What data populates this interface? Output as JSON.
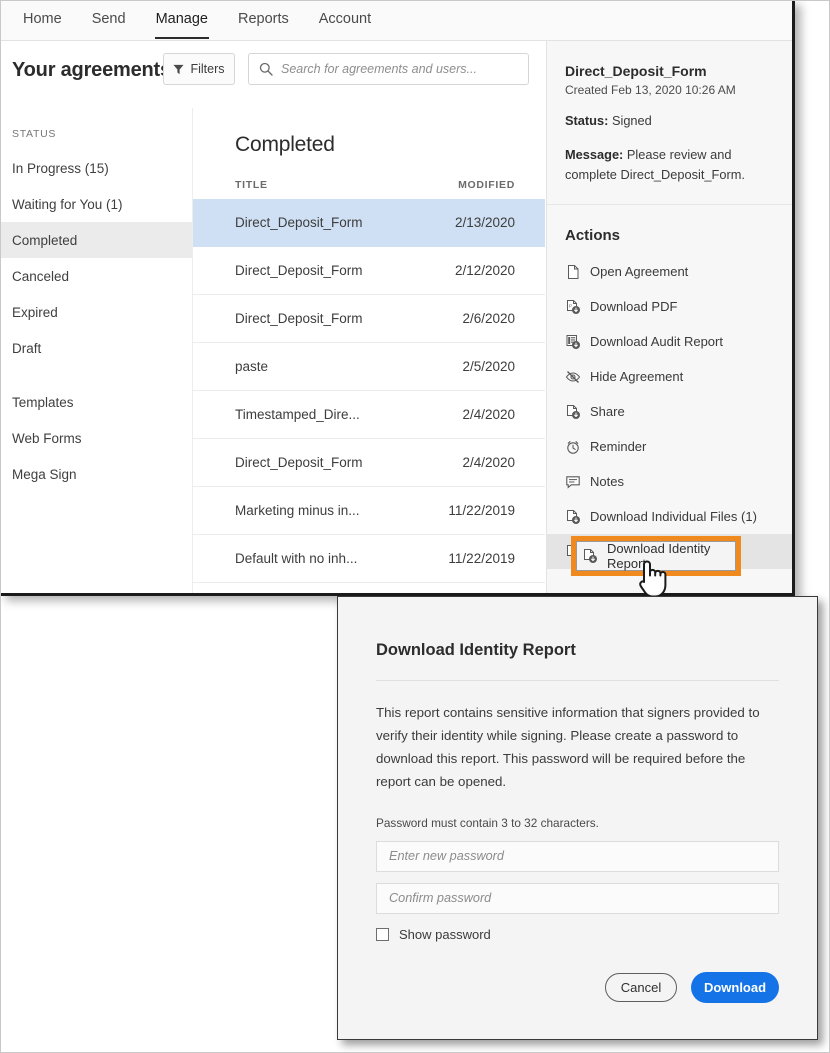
{
  "colors": {
    "accent_blue": "#1473E6",
    "callout_orange": "#F08A1E",
    "selected_row_blue": "#CFE0F4",
    "panel_gray": "#F7F7F7"
  },
  "topnav": {
    "items": [
      {
        "label": "Home",
        "active": false
      },
      {
        "label": "Send",
        "active": false
      },
      {
        "label": "Manage",
        "active": true
      },
      {
        "label": "Reports",
        "active": false
      },
      {
        "label": "Account",
        "active": false
      }
    ]
  },
  "header": {
    "title": "Your agreements",
    "filters_label": "Filters",
    "filters_icon": "funnel-icon",
    "search": {
      "icon": "search-icon",
      "value": "",
      "placeholder": "Search for agreements and users..."
    }
  },
  "sidebar": {
    "heading": "STATUS",
    "items": [
      {
        "label": "In Progress (15)",
        "selected": false
      },
      {
        "label": "Waiting for You (1)",
        "selected": false
      },
      {
        "label": "Completed",
        "selected": true
      },
      {
        "label": "Canceled",
        "selected": false
      },
      {
        "label": "Expired",
        "selected": false
      },
      {
        "label": "Draft",
        "selected": false
      }
    ],
    "secondary_items": [
      {
        "label": "Templates"
      },
      {
        "label": "Web Forms"
      },
      {
        "label": "Mega Sign"
      }
    ]
  },
  "list": {
    "title": "Completed",
    "columns": {
      "title": "TITLE",
      "modified": "MODIFIED"
    },
    "rows": [
      {
        "title": "Direct_Deposit_Form",
        "modified": "2/13/2020",
        "selected": true
      },
      {
        "title": "Direct_Deposit_Form",
        "modified": "2/12/2020",
        "selected": false
      },
      {
        "title": "Direct_Deposit_Form",
        "modified": "2/6/2020",
        "selected": false
      },
      {
        "title": "paste",
        "modified": "2/5/2020",
        "selected": false
      },
      {
        "title": "Timestamped_Dire...",
        "modified": "2/4/2020",
        "selected": false
      },
      {
        "title": "Direct_Deposit_Form",
        "modified": "2/4/2020",
        "selected": false
      },
      {
        "title": "Marketing minus in...",
        "modified": "11/22/2019",
        "selected": false
      },
      {
        "title": "Default with no inh...",
        "modified": "11/22/2019",
        "selected": false
      }
    ]
  },
  "detail": {
    "doc_name": "Direct_Deposit_Form",
    "created": "Created Feb 13, 2020 10:26 AM",
    "status_label": "Status:",
    "status_value": "Signed",
    "message_label": "Message:",
    "message_value": "Please review and complete Direct_Deposit_Form.",
    "actions_title": "Actions",
    "actions": [
      {
        "label": "Open Agreement",
        "icon": "document-icon",
        "hovered": false
      },
      {
        "label": "Download PDF",
        "icon": "pdf-download-icon",
        "hovered": false
      },
      {
        "label": "Download Audit Report",
        "icon": "audit-report-download-icon",
        "hovered": false
      },
      {
        "label": "Hide Agreement",
        "icon": "eye-slash-icon",
        "hovered": false
      },
      {
        "label": "Share",
        "icon": "document-download-icon",
        "hovered": false
      },
      {
        "label": "Reminder",
        "icon": "alarm-clock-icon",
        "hovered": false
      },
      {
        "label": "Notes",
        "icon": "speech-bubble-icon",
        "hovered": false
      },
      {
        "label": "Download Individual Files (1)",
        "icon": "document-download-icon",
        "hovered": false
      },
      {
        "label": "Download Identity Report",
        "icon": "document-download-icon",
        "hovered": true
      }
    ]
  },
  "callout": {
    "target_label": "Download Identity Report",
    "icon": "document-download-icon",
    "cursor_icon": "hand-pointer-cursor"
  },
  "modal": {
    "title": "Download Identity Report",
    "body": "This report contains sensitive information that signers provided to verify their identity while signing. Please create a password to download this report. This password will be required before the report can be opened.",
    "hint": "Password must contain 3 to 32 characters.",
    "password_field": {
      "value": "",
      "placeholder": "Enter new password"
    },
    "confirm_field": {
      "value": "",
      "placeholder": "Confirm password"
    },
    "show_password": {
      "label": "Show password",
      "checked": false
    },
    "cancel_label": "Cancel",
    "download_label": "Download"
  }
}
